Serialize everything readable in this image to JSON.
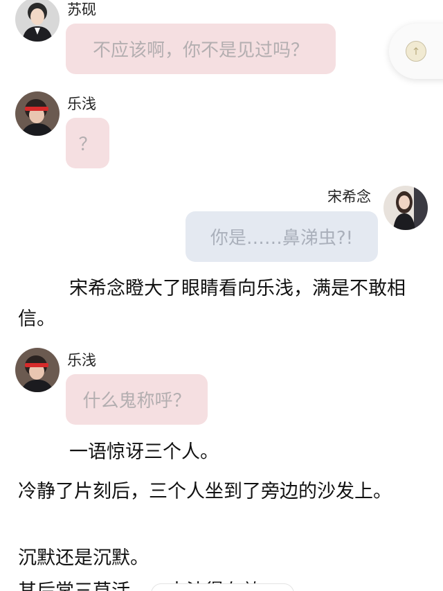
{
  "messages": [
    {
      "sender": "苏砚",
      "text": "不应该啊，你不是见过吗？",
      "side": "left",
      "avatar_icon": "male-avatar-icon"
    },
    {
      "sender": "乐浅",
      "text": "？",
      "side": "left",
      "avatar_icon": "red-headband-avatar-icon"
    },
    {
      "sender": "宋希念",
      "text": "你是……鼻涕虫?!",
      "side": "right",
      "avatar_icon": "female-avatar-icon"
    },
    {
      "sender": "乐浅",
      "text": "什么鬼称呼？",
      "side": "left",
      "avatar_icon": "red-headband-avatar-icon"
    }
  ],
  "narration": [
    "宋希念瞪大了眼睛看向乐浅，满是不敢相信。",
    "一语惊讶三个人。",
    "冷静了片刻后，三个人坐到了旁边的沙发上。",
    "沉默还是沉默。",
    "其后常三草活……来法得有效"
  ],
  "colors": {
    "left_bubble": "#f5dfe1",
    "right_bubble": "#e4e9f1",
    "bubble_text": "#b3aeb0"
  }
}
